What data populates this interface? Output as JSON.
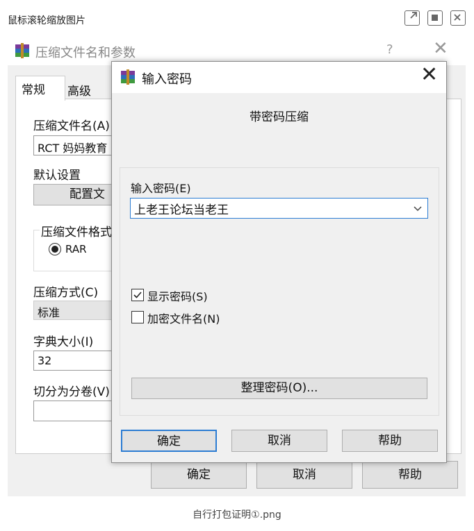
{
  "viewer": {
    "title": "鼠标滚轮缩放图片",
    "caption": "自行打包证明①.png"
  },
  "main_dialog": {
    "title": "压缩文件名和参数",
    "help": "?",
    "tabs": [
      "常规",
      "高级"
    ],
    "archive_name_label": "压缩文件名(A)",
    "archive_name_value": "RCT 妈妈教育",
    "default_settings_label": "默认设置",
    "profiles_button": "配置文",
    "format_group_label": "压缩文件格式",
    "format_rar": "RAR",
    "method_label": "压缩方式(C)",
    "method_value": "标准",
    "dict_label": "字典大小(I)",
    "dict_value": "32",
    "split_label": "切分为分卷(V)",
    "ok": "确定",
    "cancel": "取消",
    "help_button": "帮助"
  },
  "password_dialog": {
    "title": "输入密码",
    "subtitle": "带密码压缩",
    "enter_label": "输入密码(E)",
    "password_value": "上老王论坛当老王",
    "show_password": "显示密码(S)",
    "show_password_checked": true,
    "encrypt_names": "加密文件名(N)",
    "encrypt_names_checked": false,
    "organize_button": "整理密码(O)...",
    "ok": "确定",
    "cancel": "取消",
    "help": "帮助"
  },
  "icons": [
    "external-link-icon",
    "fullscreen-icon",
    "close-icon",
    "winrar-icon",
    "chevron-down-icon",
    "checkmark-icon"
  ]
}
